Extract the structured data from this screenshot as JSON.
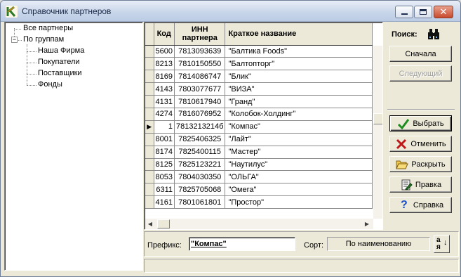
{
  "window": {
    "title": "Справочник партнеров"
  },
  "tree": {
    "nodes": [
      {
        "label": "Все партнеры"
      },
      {
        "label": "По группам",
        "expander": "−"
      },
      {
        "label": "Наша Фирма"
      },
      {
        "label": "Покупатели"
      },
      {
        "label": "Поставщики"
      },
      {
        "label": "Фонды"
      }
    ]
  },
  "grid": {
    "headers": {
      "code": "Код",
      "inn_line1": "ИНН",
      "inn_line2": "партнера",
      "name": "Краткое название"
    },
    "current_row_index": 6,
    "rows": [
      {
        "code": "5600",
        "inn": "7813093639",
        "name": "\"Балтика Foods\""
      },
      {
        "code": "8213",
        "inn": "7810150550",
        "name": "\"Балтопторг\""
      },
      {
        "code": "8169",
        "inn": "7814086747",
        "name": "\"Блик\""
      },
      {
        "code": "4143",
        "inn": "7803077677",
        "name": "\"ВИЗА\""
      },
      {
        "code": "4131",
        "inn": "7810617940",
        "name": "\"Гранд\""
      },
      {
        "code": "4274",
        "inn": "7816076952",
        "name": "\"Колобок-Холдинг\""
      },
      {
        "code": "1",
        "inn": "7813213214б",
        "name": "\"Компас\""
      },
      {
        "code": "8001",
        "inn": "7825406325",
        "name": "\"Лайт\""
      },
      {
        "code": "8174",
        "inn": "7825400115",
        "name": "\"Мастер\""
      },
      {
        "code": "8125",
        "inn": "7825123221",
        "name": "\"Наутилус\""
      },
      {
        "code": "8053",
        "inn": "7804030350",
        "name": "\"ОЛЬГА\""
      },
      {
        "code": "6311",
        "inn": "7825705068",
        "name": "\"Омега\""
      },
      {
        "code": "4161",
        "inn": "7801061801",
        "name": "\"Простор\""
      }
    ]
  },
  "side": {
    "search_label": "Поиск:",
    "first_label": "Сначала",
    "next_label": "Следующий",
    "select_label": "Выбрать",
    "cancel_label": "Отменить",
    "expand_label": "Раскрыть",
    "edit_label": "Правка",
    "help_label": "Справка"
  },
  "bottom": {
    "prefix_label": "Префикс:",
    "prefix_value": "\"Компас\"",
    "sort_label": "Сорт:",
    "sort_value": "По наименованию",
    "sort_btn_top": "а",
    "sort_btn_bottom": "я"
  },
  "colors": {
    "check_green": "#1e8c1e",
    "cancel_red": "#c01818",
    "help_blue": "#1a50c8",
    "folder_yellow": "#f0c848"
  }
}
